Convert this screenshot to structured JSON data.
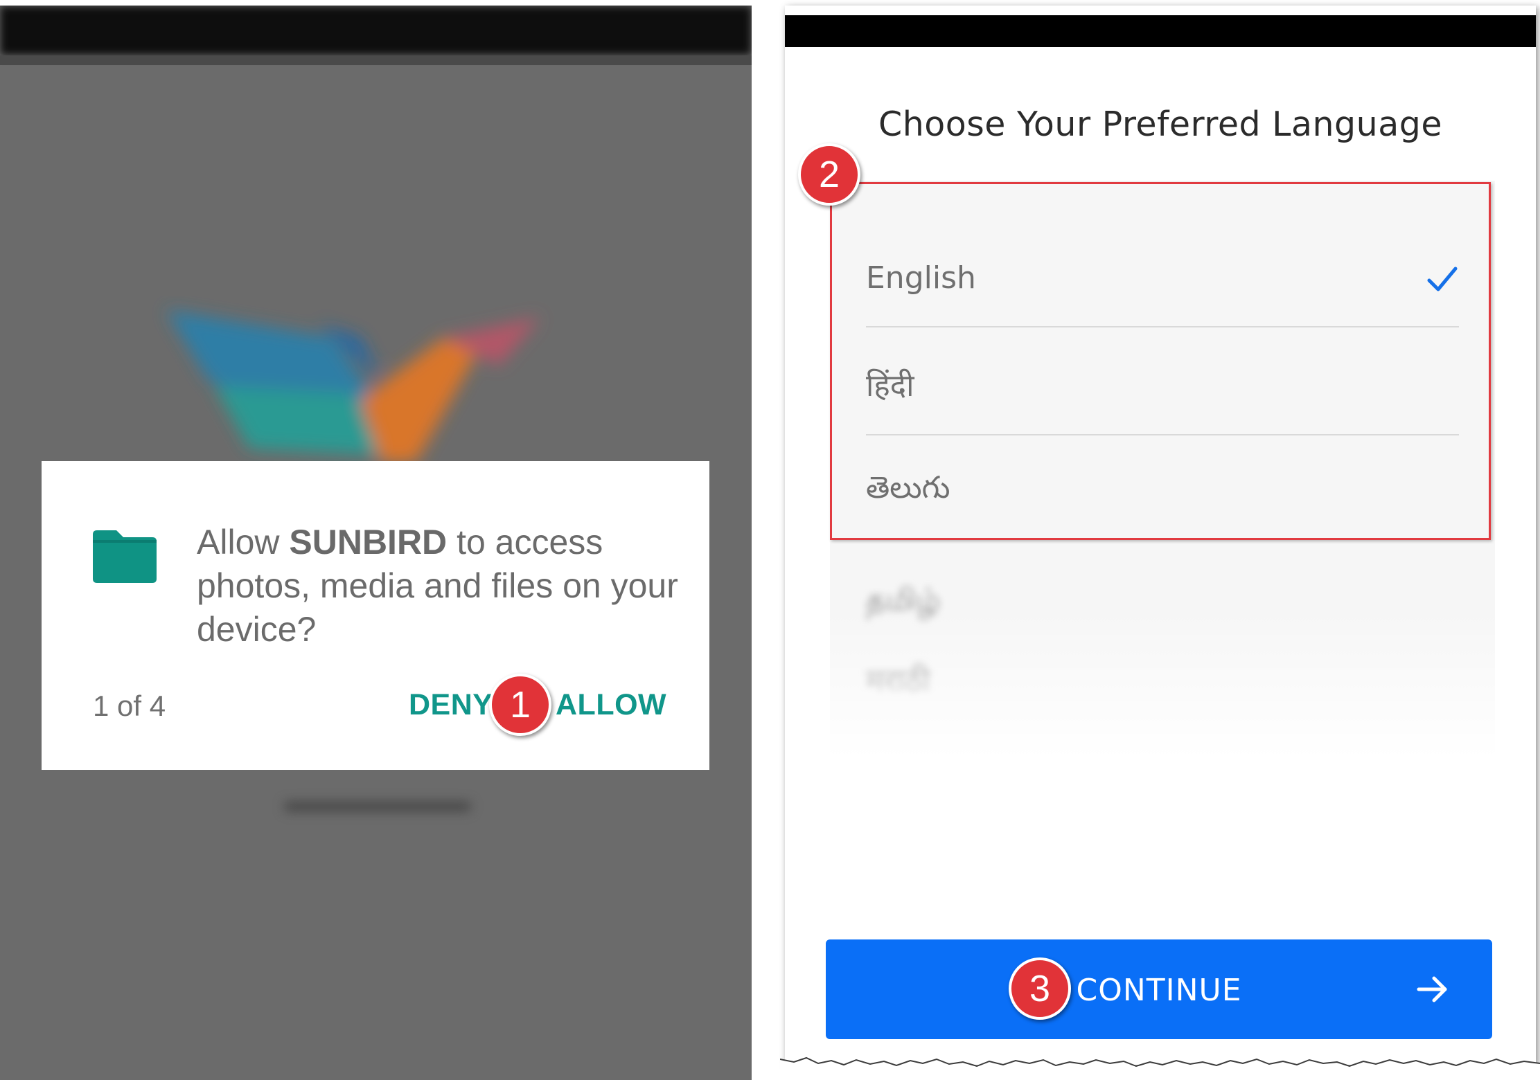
{
  "permission_dialog": {
    "text_prefix": "Allow ",
    "app_name": "SUNBIRD",
    "text_suffix": " to access photos, media and files on your device?",
    "counter": "1 of 4",
    "deny_label": "DENY",
    "allow_label": "ALLOW",
    "folder_icon": "folder-icon",
    "accent_color": "#10968a"
  },
  "language_screen": {
    "title": "Choose Your Preferred Language",
    "languages": [
      {
        "label": "English",
        "selected": true
      },
      {
        "label": "हिंदी",
        "selected": false
      },
      {
        "label": "తెలుగు",
        "selected": false
      },
      {
        "label": "தமிழ்",
        "selected": false
      },
      {
        "label": "मराठी",
        "selected": false
      }
    ],
    "check_icon": "checkmark-icon",
    "continue_label": "CONTINUE",
    "continue_icon": "arrow-right-icon",
    "button_color": "#0a6ff7"
  },
  "callouts": {
    "badge_1": "1",
    "badge_2": "2",
    "badge_3": "3",
    "badge_color": "#e13338"
  }
}
